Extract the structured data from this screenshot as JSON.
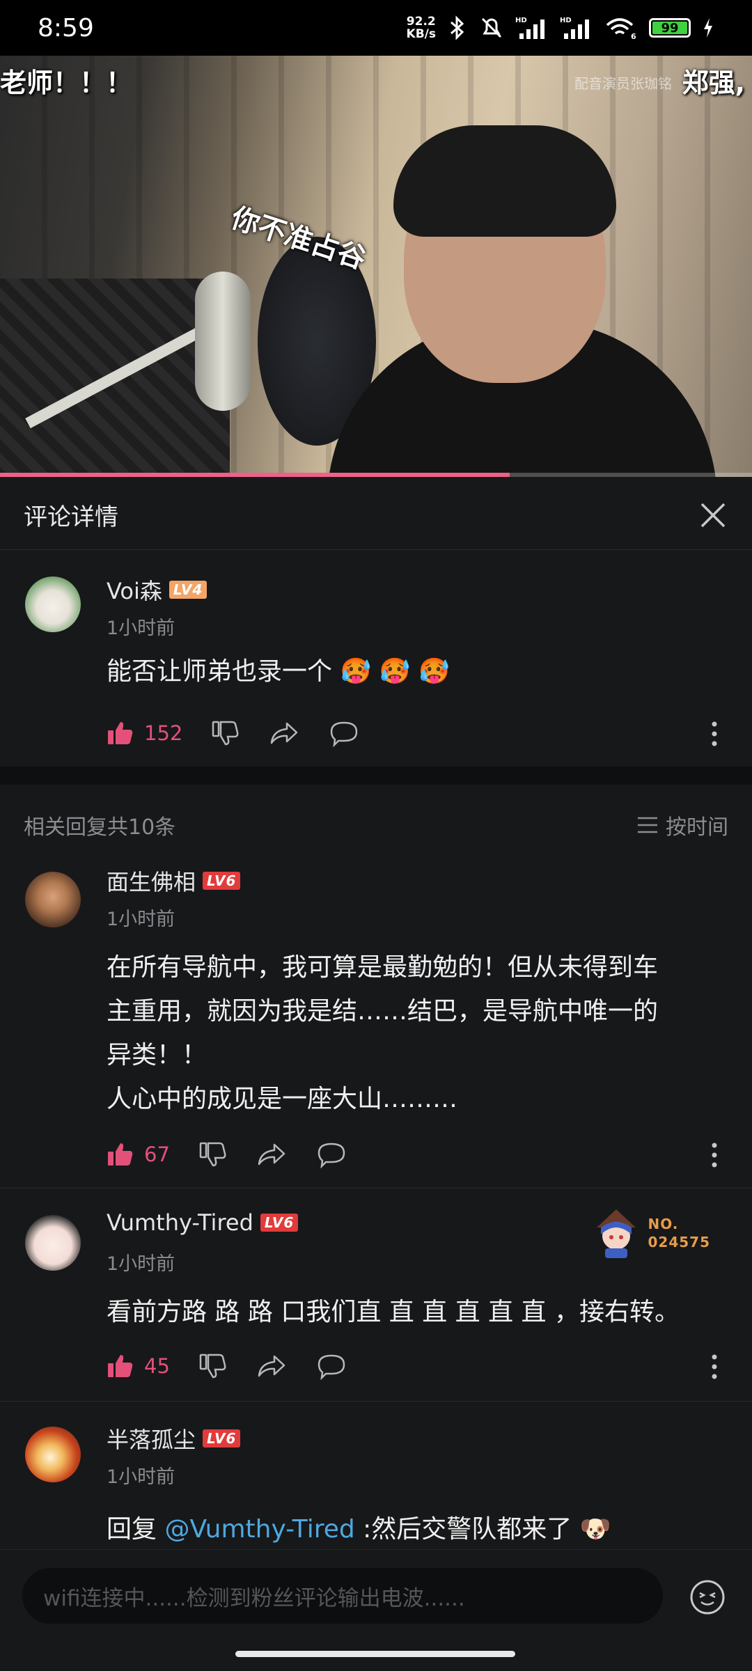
{
  "status_bar": {
    "time": "8:59",
    "net_speed_value": "92.2",
    "net_speed_unit": "KB/s",
    "battery": "99",
    "battery_color": "#3fd13f",
    "icons": [
      "bluetooth-icon",
      "mute-bell-icon",
      "hd-signal-icon",
      "hd-signal-icon",
      "wifi-6-icon",
      "battery-icon",
      "charging-icon"
    ]
  },
  "video": {
    "overlay_left": "老师！！！",
    "overlay_right": "郑强,",
    "overlay_faint": "配音演员张珈铭",
    "overlay_center": "你不准占谷",
    "progress_fraction": 0.678,
    "progress_color": "#f0608a"
  },
  "panel": {
    "title": "评论详情"
  },
  "main_comment": {
    "username": "Voi森",
    "level": "LV4",
    "time": "1小时前",
    "text": "能否让师弟也录一个",
    "emojis": [
      "🥵",
      "🥵",
      "🥵"
    ],
    "likes": "152"
  },
  "replies": {
    "count_label": "相关回复共10条",
    "sort_label": "按时间",
    "items": [
      {
        "username": "面生佛相",
        "level": "LV6",
        "time": "1小时前",
        "text_lines": [
          "在所有导航中，我可算是最勤勉的！但从未得到车",
          "主重用，就因为我是结……结巴，是导航中唯一的",
          "异类！！",
          "人心中的成见是一座大山………"
        ],
        "likes": "67"
      },
      {
        "username": "Vumthy-Tired",
        "level": "LV6",
        "time": "1小时前",
        "badge_label": "NO.",
        "badge_number": "024575",
        "text": "看前方路 路 路 口我们直 直 直 直 直 直 ，接右转。",
        "likes": "45"
      },
      {
        "username": "半落孤尘",
        "level": "LV6",
        "time": "1小时前",
        "reply_prefix": "回复 ",
        "mention": "@Vumthy-Tired",
        "text": " :然后交警队都来了",
        "emoji": "🐶"
      }
    ]
  },
  "input": {
    "placeholder": "wifi连接中......检测到粉丝评论输出电波......"
  },
  "colors": {
    "accent_like": "#e3507a",
    "mention": "#4ea8e0",
    "background": "#17181a"
  }
}
